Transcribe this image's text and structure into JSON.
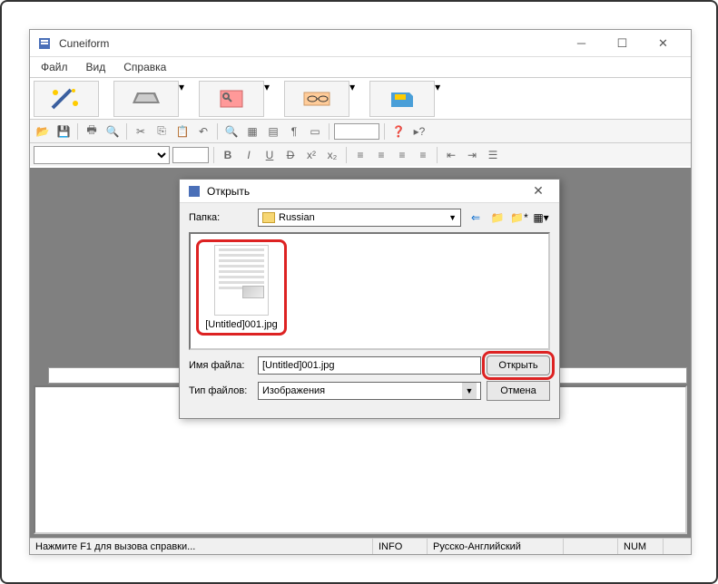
{
  "main": {
    "title": "Cuneiform",
    "menu": {
      "file": "Файл",
      "view": "Вид",
      "help": "Справка"
    },
    "status": {
      "hint": "Нажмите F1 для вызова справки...",
      "info": "INFO",
      "lang": "Русско-Английский",
      "num": "NUM"
    }
  },
  "dialog": {
    "title": "Открыть",
    "folder_label": "Папка:",
    "folder_name": "Russian",
    "file_item": "[Untitled]001.jpg",
    "filename_label": "Имя файла:",
    "filename_value": "[Untitled]001.jpg",
    "filetype_label": "Тип файлов:",
    "filetype_value": "Изображения",
    "open_btn": "Открыть",
    "cancel_btn": "Отмена"
  }
}
